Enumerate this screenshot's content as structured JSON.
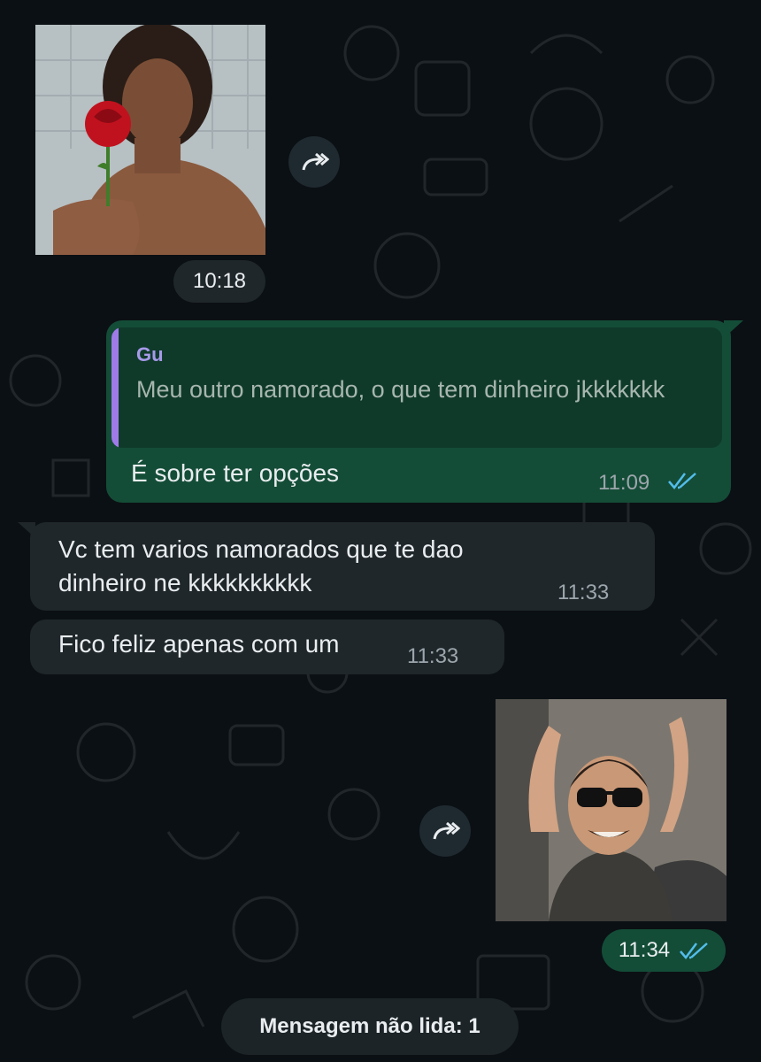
{
  "colors": {
    "background": "#0b1014",
    "incoming_bubble": "#1f272b",
    "outgoing_bubble": "#144d37",
    "quote_bar": "#a07be8",
    "read_ticks": "#53bdeb"
  },
  "messages": [
    {
      "type": "image",
      "direction": "incoming",
      "time": "10:18",
      "forward_icon": "forward-icon"
    },
    {
      "type": "text",
      "direction": "outgoing",
      "quote": {
        "author": "Gu",
        "text": "Meu outro namorado, o que tem dinheiro jkkkkkkk"
      },
      "text": "É sobre ter opções",
      "time": "11:09",
      "status_icon": "double-check-icon"
    },
    {
      "type": "text",
      "direction": "incoming",
      "text": "Vc tem varios namorados que te dao dinheiro ne kkkkkkkkkk",
      "time": "11:33"
    },
    {
      "type": "text",
      "direction": "incoming",
      "text": "Fico feliz apenas com um",
      "time": "11:33"
    },
    {
      "type": "image",
      "direction": "outgoing",
      "time": "11:34",
      "status_icon": "double-check-icon",
      "forward_icon": "forward-icon"
    }
  ],
  "unread_banner": "Mensagem não lida: 1"
}
